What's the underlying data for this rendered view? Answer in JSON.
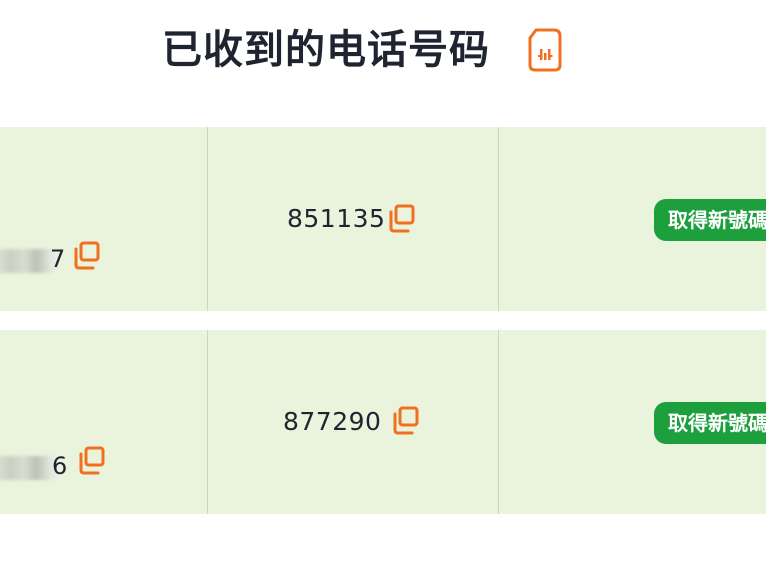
{
  "header": {
    "title": "已收到的电话号码",
    "icon": "sim-card-icon"
  },
  "colors": {
    "accent": "#f07020",
    "row_bg": "#eaf4dc",
    "button_bg": "#1e9f3d"
  },
  "rows": [
    {
      "phone_visible_suffix": "7",
      "phone_masked": "██████",
      "code": "851135",
      "button_label": "取得新號碼"
    },
    {
      "phone_visible_suffix": "6",
      "phone_masked": "██████",
      "code": "877290",
      "button_label": "取得新號碼"
    }
  ]
}
